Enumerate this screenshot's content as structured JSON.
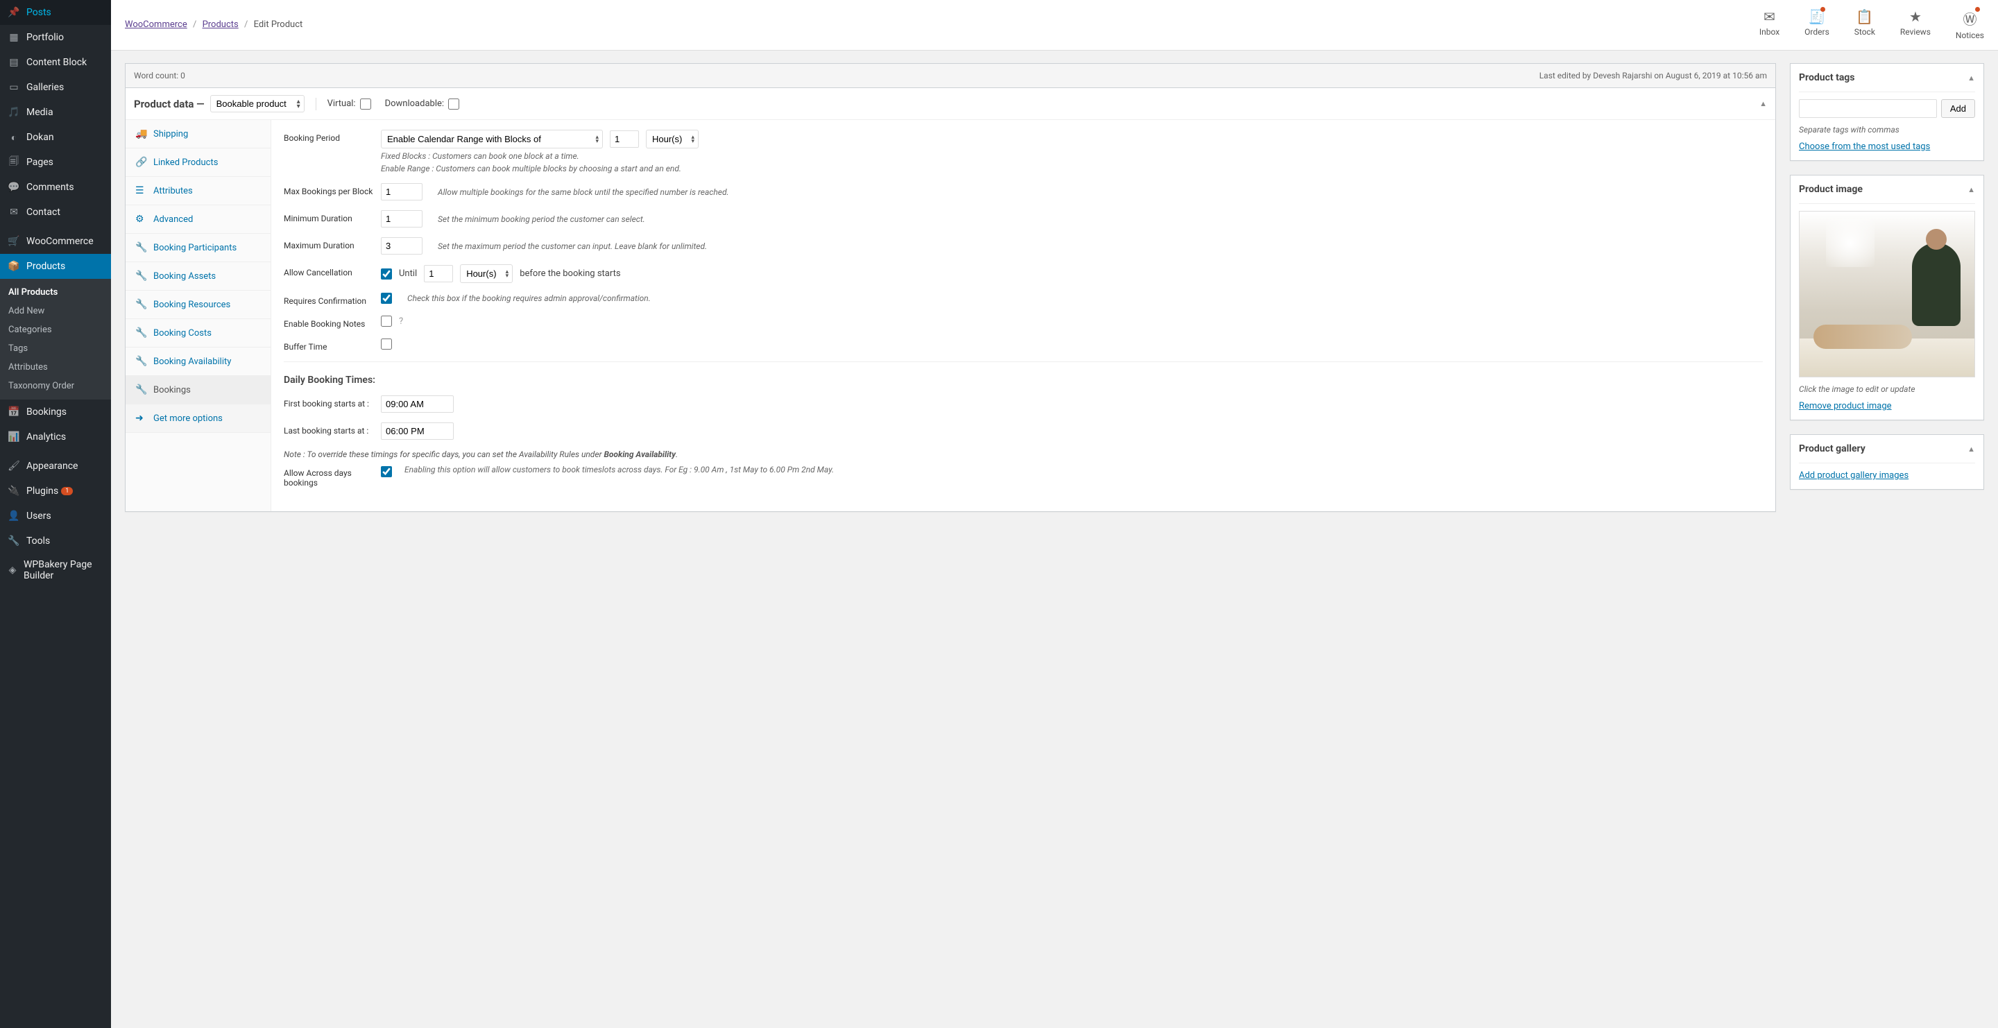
{
  "breadcrumb": {
    "a": "WooCommerce",
    "b": "Products",
    "c": "Edit Product"
  },
  "topicons": {
    "inbox": "Inbox",
    "orders": "Orders",
    "stock": "Stock",
    "reviews": "Reviews",
    "notices": "Notices"
  },
  "sidebar": {
    "posts": "Posts",
    "portfolio": "Portfolio",
    "contentblock": "Content Block",
    "galleries": "Galleries",
    "media": "Media",
    "dokan": "Dokan",
    "pages": "Pages",
    "comments": "Comments",
    "contact": "Contact",
    "woocommerce": "WooCommerce",
    "products": "Products",
    "sub_all": "All Products",
    "sub_add": "Add New",
    "sub_cat": "Categories",
    "sub_tags": "Tags",
    "sub_attr": "Attributes",
    "sub_tax": "Taxonomy Order",
    "bookings": "Bookings",
    "analytics": "Analytics",
    "appearance": "Appearance",
    "plugins": "Plugins",
    "plugins_count": "1",
    "users": "Users",
    "tools": "Tools",
    "wpbakery": "WPBakery Page Builder"
  },
  "wordbar": {
    "count": "Word count: 0",
    "edited": "Last edited by Devesh Rajarshi on August 6, 2019 at 10:56 am"
  },
  "pdata": {
    "title": "Product data —",
    "type_select": "Bookable product",
    "virtual": "Virtual:",
    "downloadable": "Downloadable:"
  },
  "tabs": {
    "shipping": "Shipping",
    "linked": "Linked Products",
    "attributes": "Attributes",
    "advanced": "Advanced",
    "participants": "Booking Participants",
    "assets": "Booking Assets",
    "resources": "Booking Resources",
    "costs": "Booking Costs",
    "availability": "Booking Availability",
    "bookings": "Bookings",
    "more": "Get more options"
  },
  "panel": {
    "booking_period": "Booking Period",
    "bp_select": "Enable Calendar Range with Blocks of",
    "bp_num": "1",
    "bp_unit": "Hour(s)",
    "bp_desc1": "Fixed Blocks : Customers can book one block at a time.",
    "bp_desc2": "Enable Range : Customers can book multiple blocks by choosing a start and an end.",
    "max_block": "Max Bookings per Block",
    "max_block_val": "1",
    "max_block_desc": "Allow multiple bookings for the same block until the specified number is reached.",
    "min_dur": "Minimum Duration",
    "min_dur_val": "1",
    "min_dur_desc": "Set the minimum booking period the customer can select.",
    "max_dur": "Maximum Duration",
    "max_dur_val": "3",
    "max_dur_desc": "Set the maximum period the customer can input. Leave blank for unlimited.",
    "cancel": "Allow Cancellation",
    "until": "Until",
    "cancel_val": "1",
    "cancel_unit": "Hour(s)",
    "cancel_after": "before the booking starts",
    "confirm": "Requires Confirmation",
    "confirm_desc": "Check this box if the booking requires admin approval/confirmation.",
    "notes": "Enable Booking Notes",
    "buffer": "Buffer Time",
    "daily_title": "Daily Booking Times:",
    "first_label": "First booking starts at :",
    "first_val": "09:00 AM",
    "last_label": "Last booking starts at :",
    "last_val": "06:00 PM",
    "note_pre": "Note : To override these timings for specific days, you can set the Availability Rules under ",
    "note_bold": "Booking Availability",
    "across": "Allow Across days bookings",
    "across_desc": "Enabling this option will allow customers to book timeslots across days. For Eg : 9.00 Am , 1st May to 6.00 Pm 2nd May."
  },
  "side": {
    "tags_title": "Product tags",
    "add_btn": "Add",
    "tags_hint": "Separate tags with commas",
    "tags_link": "Choose from the most used tags",
    "image_title": "Product image",
    "image_hint": "Click the image to edit or update",
    "image_remove": "Remove product image",
    "gallery_title": "Product gallery",
    "gallery_link": "Add product gallery images"
  }
}
